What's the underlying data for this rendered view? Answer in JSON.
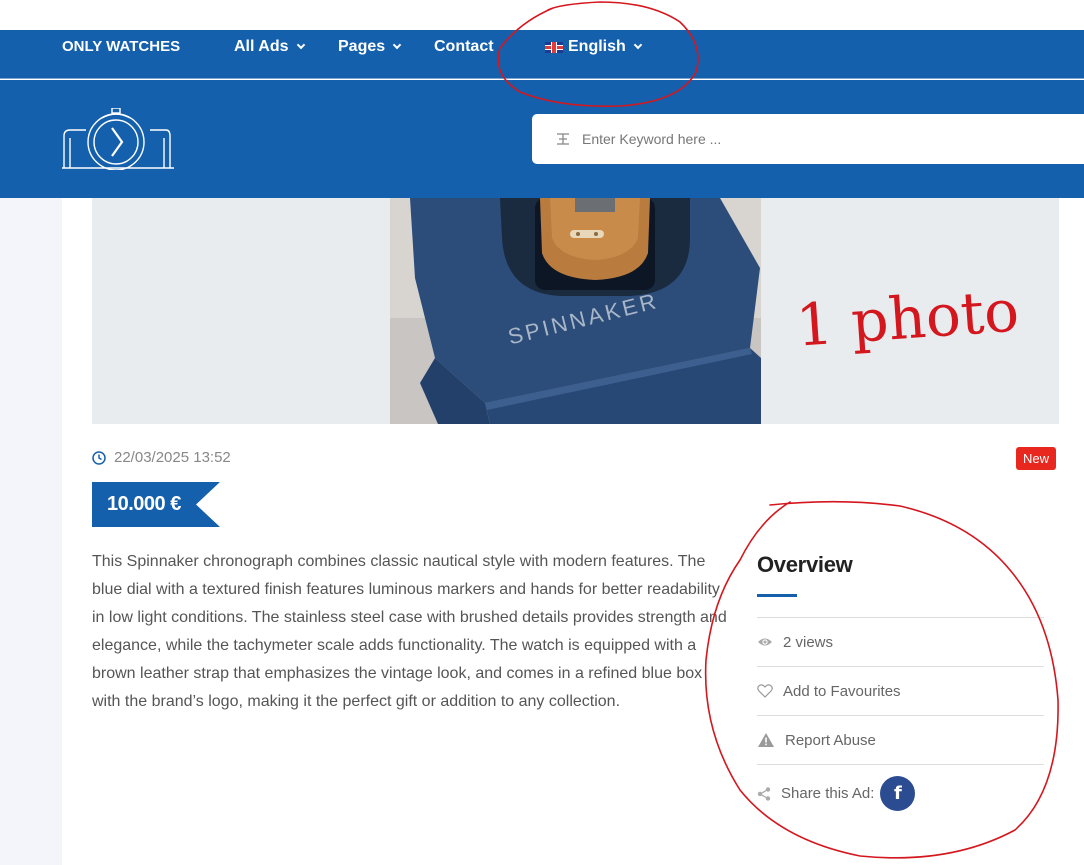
{
  "nav": {
    "brand": "ONLY WATCHES",
    "items": [
      {
        "label": "All Ads",
        "dropdown": true
      },
      {
        "label": "Pages",
        "dropdown": true
      },
      {
        "label": "Contact",
        "dropdown": false
      }
    ],
    "language": "English"
  },
  "search": {
    "placeholder": "Enter Keyword here ..."
  },
  "colors": {
    "primary": "#1560ad",
    "badge": "#e8281f",
    "facebook": "#2b4c91",
    "annotation": "#d4171e"
  },
  "listing": {
    "photo_text": "SPINNAKER",
    "date": "22/03/2025 13:52",
    "badge": "New",
    "price": "10.000 €",
    "description": "This Spinnaker chronograph combines classic nautical style with modern features. The blue dial with a textured finish features luminous markers and hands for better readability in low light conditions. The stainless steel case with brushed details provides strength and elegance, while the tachymeter scale adds functionality. The watch is equipped with a brown leather strap that emphasizes the vintage look, and comes in a refined blue box with the brand’s logo, making it the perfect gift or addition to any collection."
  },
  "overview": {
    "title": "Overview",
    "views": "2 views",
    "favourites": "Add to Favourites",
    "report": "Report Abuse",
    "share": "Share this Ad:",
    "share_icon": "f"
  },
  "annotation": {
    "note": "1 photo"
  }
}
